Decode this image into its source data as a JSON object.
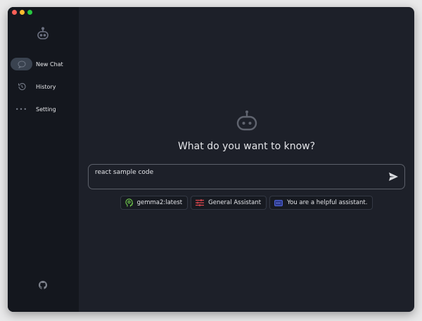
{
  "sidebar": {
    "items": [
      {
        "label": "New Chat",
        "icon": "chat-bubble-icon",
        "active": true
      },
      {
        "label": "History",
        "icon": "history-icon"
      },
      {
        "label": "Setting",
        "icon": "more-dots-icon"
      }
    ]
  },
  "main": {
    "heading": "What do you want to know?",
    "input_value": "react sample code",
    "chips": [
      {
        "label": "gemma2:latest",
        "icon": "head-brain-icon",
        "color": "#6cc04a"
      },
      {
        "label": "General Assistant",
        "icon": "sliders-icon",
        "color": "#e0484e"
      },
      {
        "label": "You are a helpful assistant.",
        "icon": "prompt-card-icon",
        "color": "#4f63d6"
      }
    ]
  }
}
